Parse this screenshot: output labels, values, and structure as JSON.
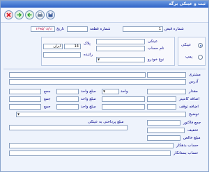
{
  "window": {
    "title": "ثبت و عینکی برگه"
  },
  "toolbar": {
    "buttons": [
      {
        "name": "delete-button",
        "icon": "red-x-icon",
        "color": "#d9202a"
      },
      {
        "name": "forward-button",
        "icon": "green-arrow-icon",
        "color": "#2ea32e"
      },
      {
        "name": "back-button",
        "icon": "green-arrow-icon",
        "color": "#2ea32e"
      },
      {
        "name": "print-button",
        "icon": "printer-icon",
        "color": "#6b7f9a"
      },
      {
        "name": "save-button",
        "icon": "floppy-icon",
        "color": "#3a5a9a"
      }
    ]
  },
  "header": {
    "receipt_label": "شماره قبض",
    "receipt_value": "1",
    "section_label": "شماره قطعه",
    "date_label": "تاریخ",
    "date_value": "۱۳۹۵/۰۸/۱۱"
  },
  "type_panel": {
    "optician_label": "عینکی",
    "dispensary_label": "پمپ"
  },
  "vehicle": {
    "optician_label": "عینکی",
    "plate_label": "پلاک",
    "plate_city": "ایران",
    "plate_number": "14",
    "account_label": "نام حساب",
    "driver_label": "راننده",
    "car_type_label": "نوع خودرو"
  },
  "form": {
    "customer_label": "مشتری",
    "address_label": "آدرس",
    "amount_label": "مقدار",
    "unit_price_label": "مبلغ واحد",
    "unit_label": "واحد",
    "container_extra_label": "اضافه کانتینر",
    "stop_extra_label": "اضافه توقف",
    "description_label": "توضیح",
    "sum_label": "جمع",
    "invoice_sum_label": "جمع فاکتور",
    "discount_label": "تخفیف",
    "net_amount_label": "مبلغ خالص",
    "paid_to_optician_label": "مبلغ پرداختی به عینکی",
    "debtor_account_label": "حساب بدهکار",
    "creditor_account_label": "حساب بستانکار"
  }
}
